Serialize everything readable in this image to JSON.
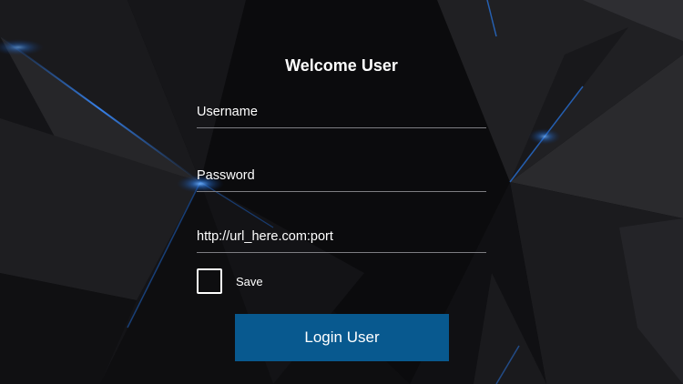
{
  "login": {
    "title": "Welcome User",
    "username_placeholder": "Username",
    "password_placeholder": "Password",
    "url_placeholder": "http://url_here.com:port",
    "save_label": "Save",
    "save_checked": false,
    "login_button_label": "Login User"
  },
  "colors": {
    "button_bg": "#08598f",
    "accent_glow": "#1e6fd6",
    "background": "#0b0b0d"
  }
}
